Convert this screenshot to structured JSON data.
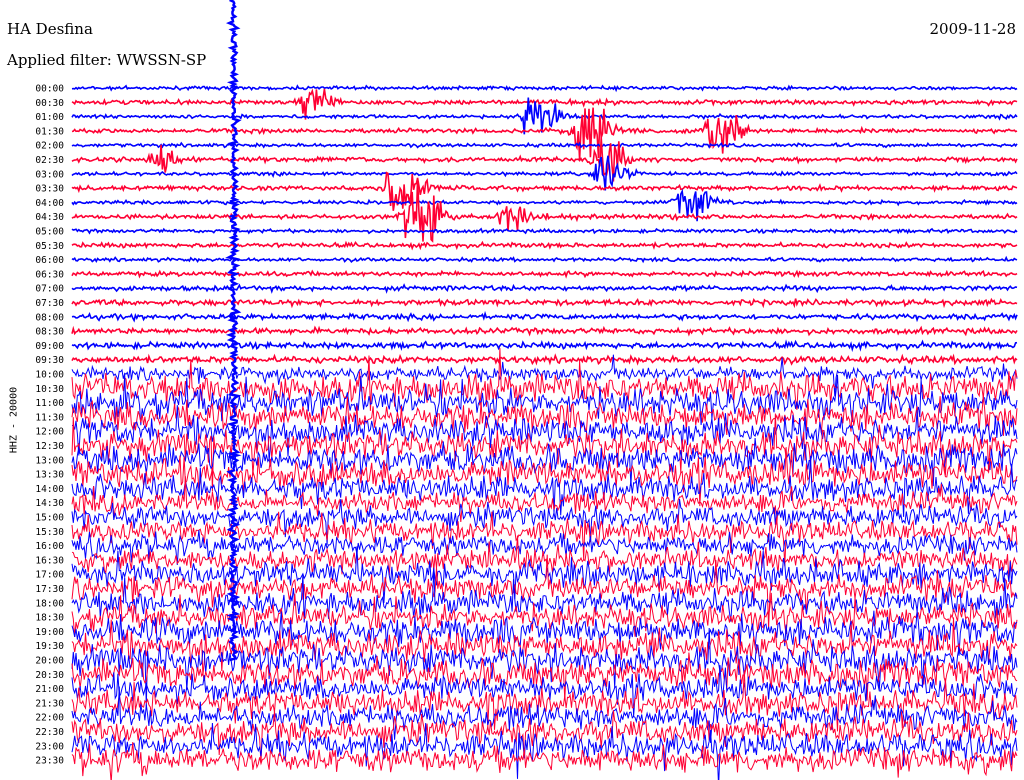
{
  "header": {
    "station": "HA Desfina",
    "filter": "Applied filter: WWSSN-SP",
    "date": "2009-11-28"
  },
  "chart_data": {
    "type": "helicorder",
    "channel_label": "HHZ - 20000",
    "row_labels": [
      "00:00",
      "00:30",
      "01:00",
      "01:30",
      "02:00",
      "02:30",
      "03:00",
      "03:30",
      "04:00",
      "04:30",
      "05:00",
      "05:30",
      "06:00",
      "06:30",
      "07:00",
      "07:30",
      "08:00",
      "08:30",
      "09:00",
      "09:30",
      "10:00",
      "10:30",
      "11:00",
      "11:30",
      "12:00",
      "12:30",
      "13:00",
      "13:30",
      "14:00",
      "14:30",
      "15:00",
      "15:30",
      "16:00",
      "16:30",
      "17:00",
      "17:30",
      "18:00",
      "18:30",
      "19:00",
      "19:30",
      "20:00",
      "20:30",
      "21:00",
      "21:30",
      "22:00",
      "22:30",
      "23:00",
      "23:30"
    ],
    "trace_colors": [
      "#0000ff",
      "#ff0033"
    ],
    "noise_level_by_row": [
      1,
      1.3,
      1,
      1.3,
      1,
      1.3,
      1,
      1.3,
      1,
      1.3,
      1,
      1.3,
      1,
      1.3,
      1.4,
      1.6,
      1.5,
      1.6,
      1.7,
      1.9,
      4,
      8,
      8,
      8,
      8,
      8,
      8,
      8,
      7,
      6,
      6,
      6,
      6,
      6,
      7,
      7,
      7,
      7,
      8,
      8,
      8,
      8,
      7,
      7,
      7,
      7,
      7,
      7
    ],
    "events": [
      {
        "row": 1,
        "x_frac": 0.25,
        "amp": 2.5
      },
      {
        "row": 2,
        "x_frac": 0.485,
        "amp": 4
      },
      {
        "row": 3,
        "x_frac": 0.54,
        "amp": 5
      },
      {
        "row": 3,
        "x_frac": 0.68,
        "amp": 4
      },
      {
        "row": 5,
        "x_frac": 0.09,
        "amp": 2
      },
      {
        "row": 5,
        "x_frac": 0.56,
        "amp": 4
      },
      {
        "row": 6,
        "x_frac": 0.56,
        "amp": 3
      },
      {
        "row": 7,
        "x_frac": 0.34,
        "amp": 5
      },
      {
        "row": 8,
        "x_frac": 0.65,
        "amp": 3
      },
      {
        "row": 9,
        "x_frac": 0.36,
        "amp": 8
      },
      {
        "row": 9,
        "x_frac": 0.46,
        "amp": 2
      }
    ],
    "spike": {
      "x_frac": 0.171,
      "from_row": 0,
      "to_row": 40,
      "color": "#0000ff"
    }
  }
}
